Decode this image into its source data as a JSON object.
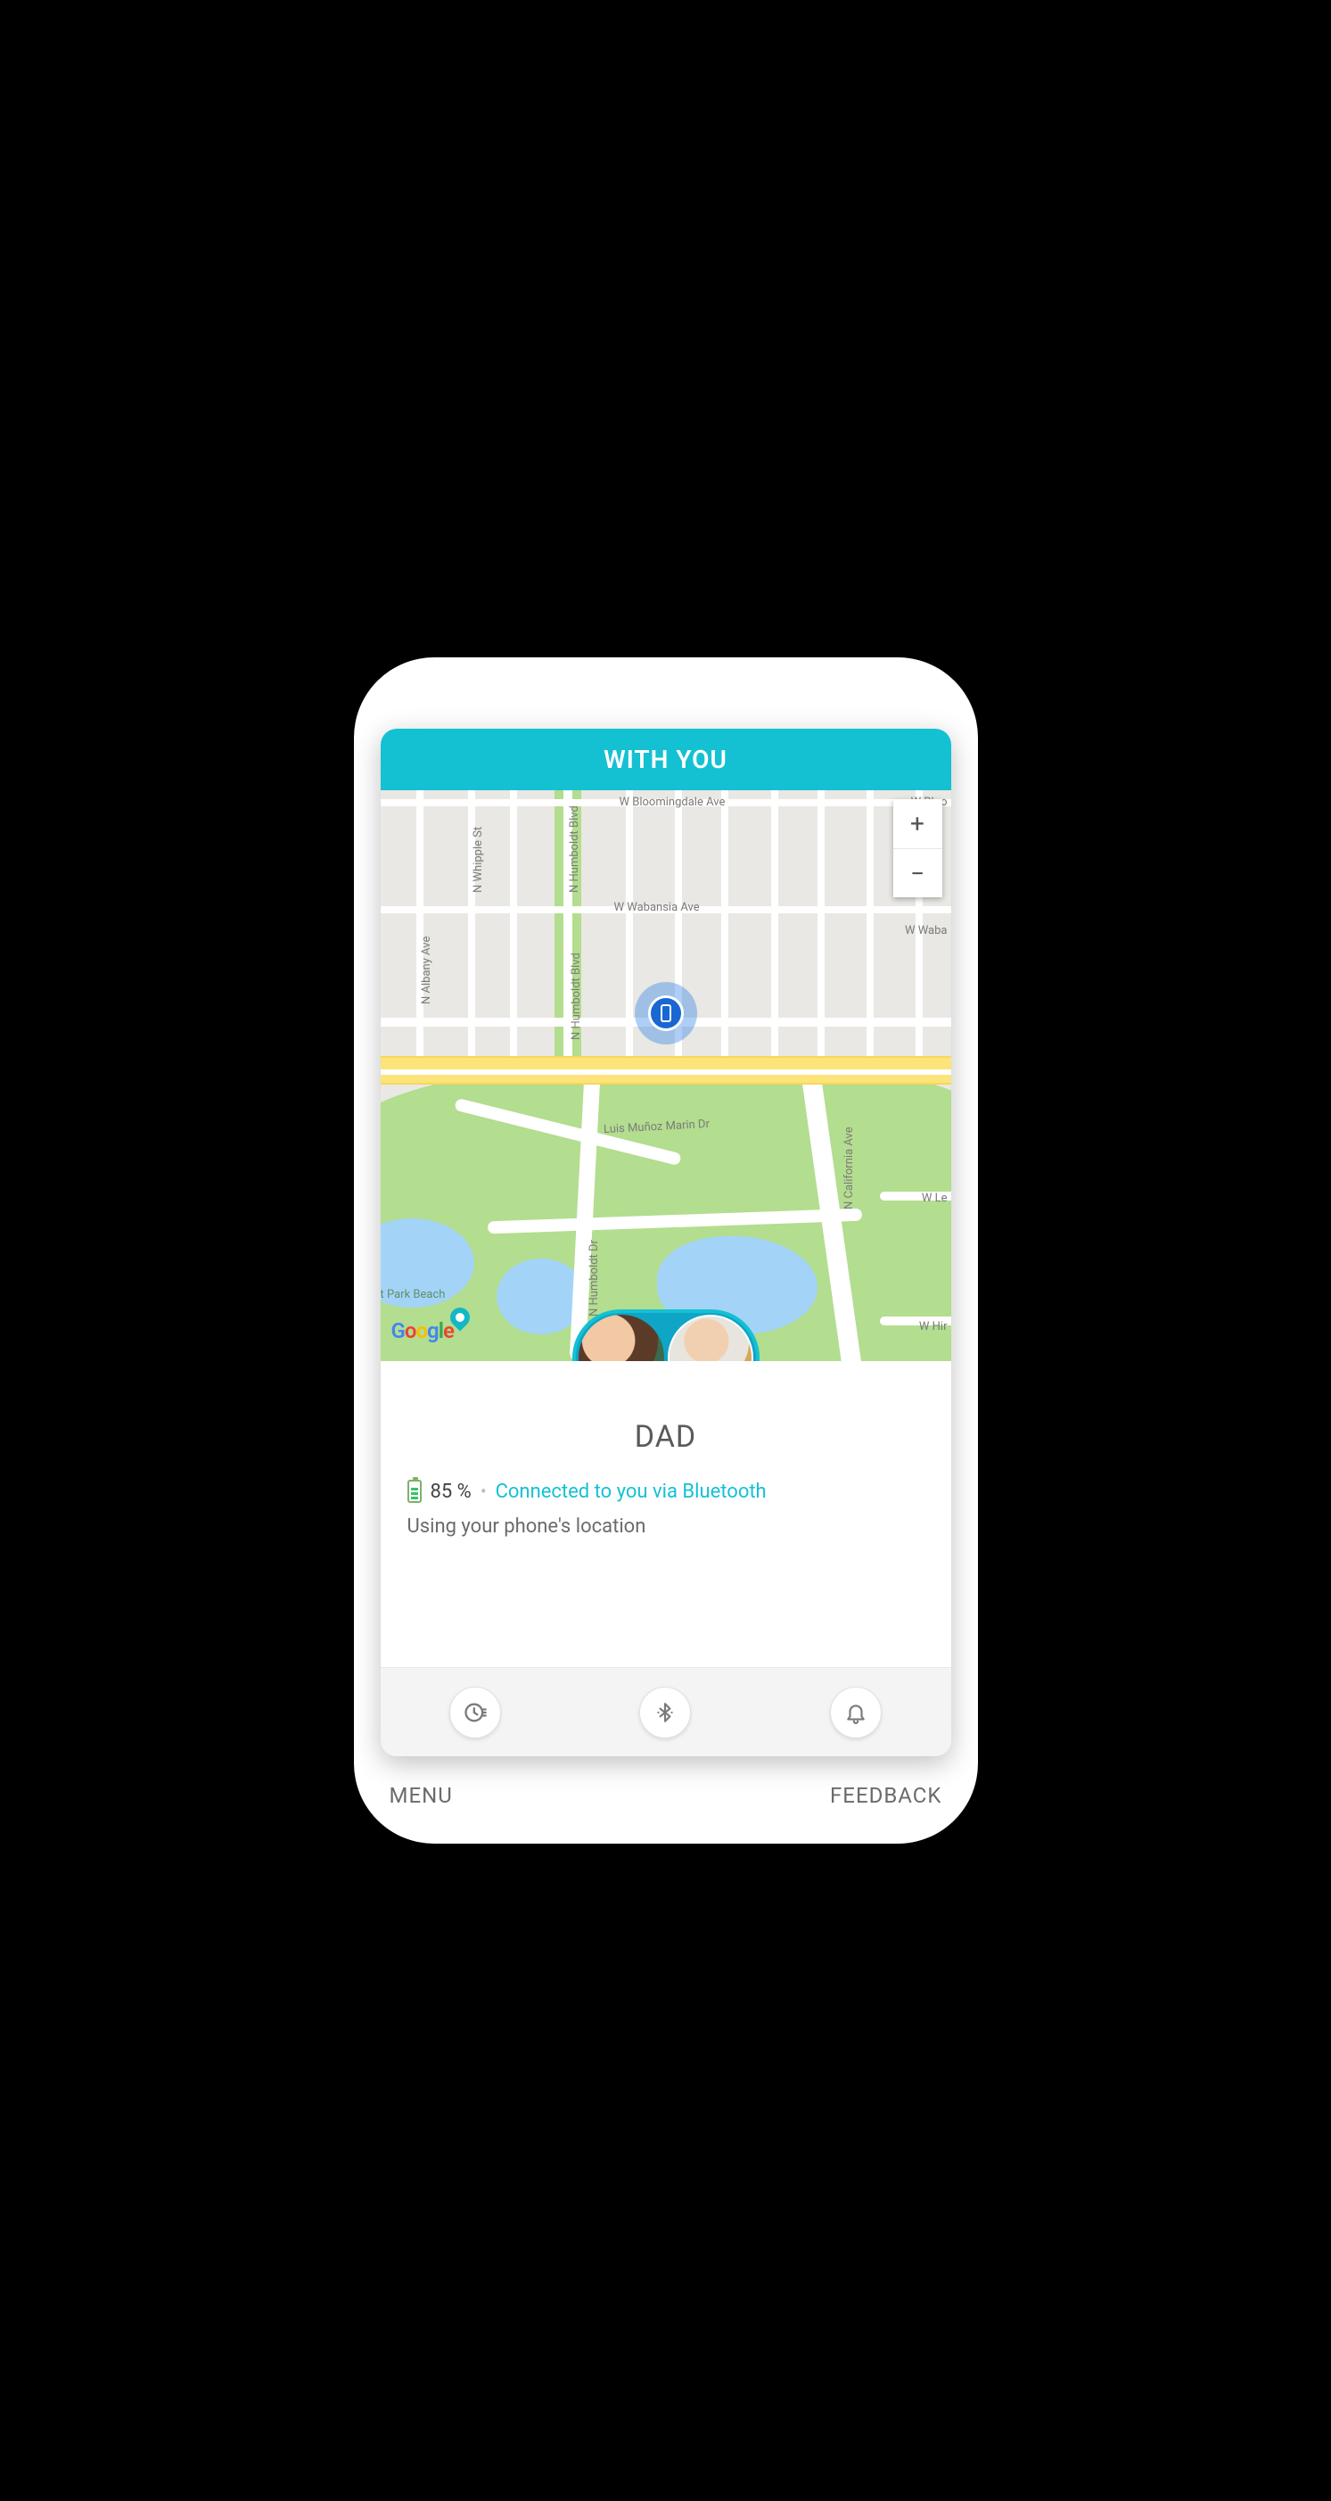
{
  "header": {
    "title": "WITH YOU"
  },
  "map": {
    "streets": {
      "humboldt_blvd": "N Humboldt Blvd",
      "bloomingdale": "W Bloomingdale Ave",
      "bloo_cut": "W Bloo",
      "whipple": "N Whipple St",
      "wabansia": "W Wabansia Ave",
      "wabansia2": "W Waba",
      "albany": "N Albany Ave",
      "california": "N California Ave",
      "humboldt_blvd2": "N Humboldt Blvd",
      "luis_munoz": "Luis Muñoz Marin Dr",
      "humboldt_dr": "N Humboldt Dr",
      "le": "W Le",
      "hir": "W Hir",
      "park_beach": "t Park Beach"
    },
    "attribution": "Google"
  },
  "zoom": {
    "in": "+",
    "out": "−"
  },
  "selected": {
    "name": "DAD",
    "battery_pct": "85 %",
    "connection": "Connected to you via Bluetooth",
    "location_source": "Using your phone's location"
  },
  "footer": {
    "menu": "MENU",
    "feedback": "FEEDBACK"
  }
}
